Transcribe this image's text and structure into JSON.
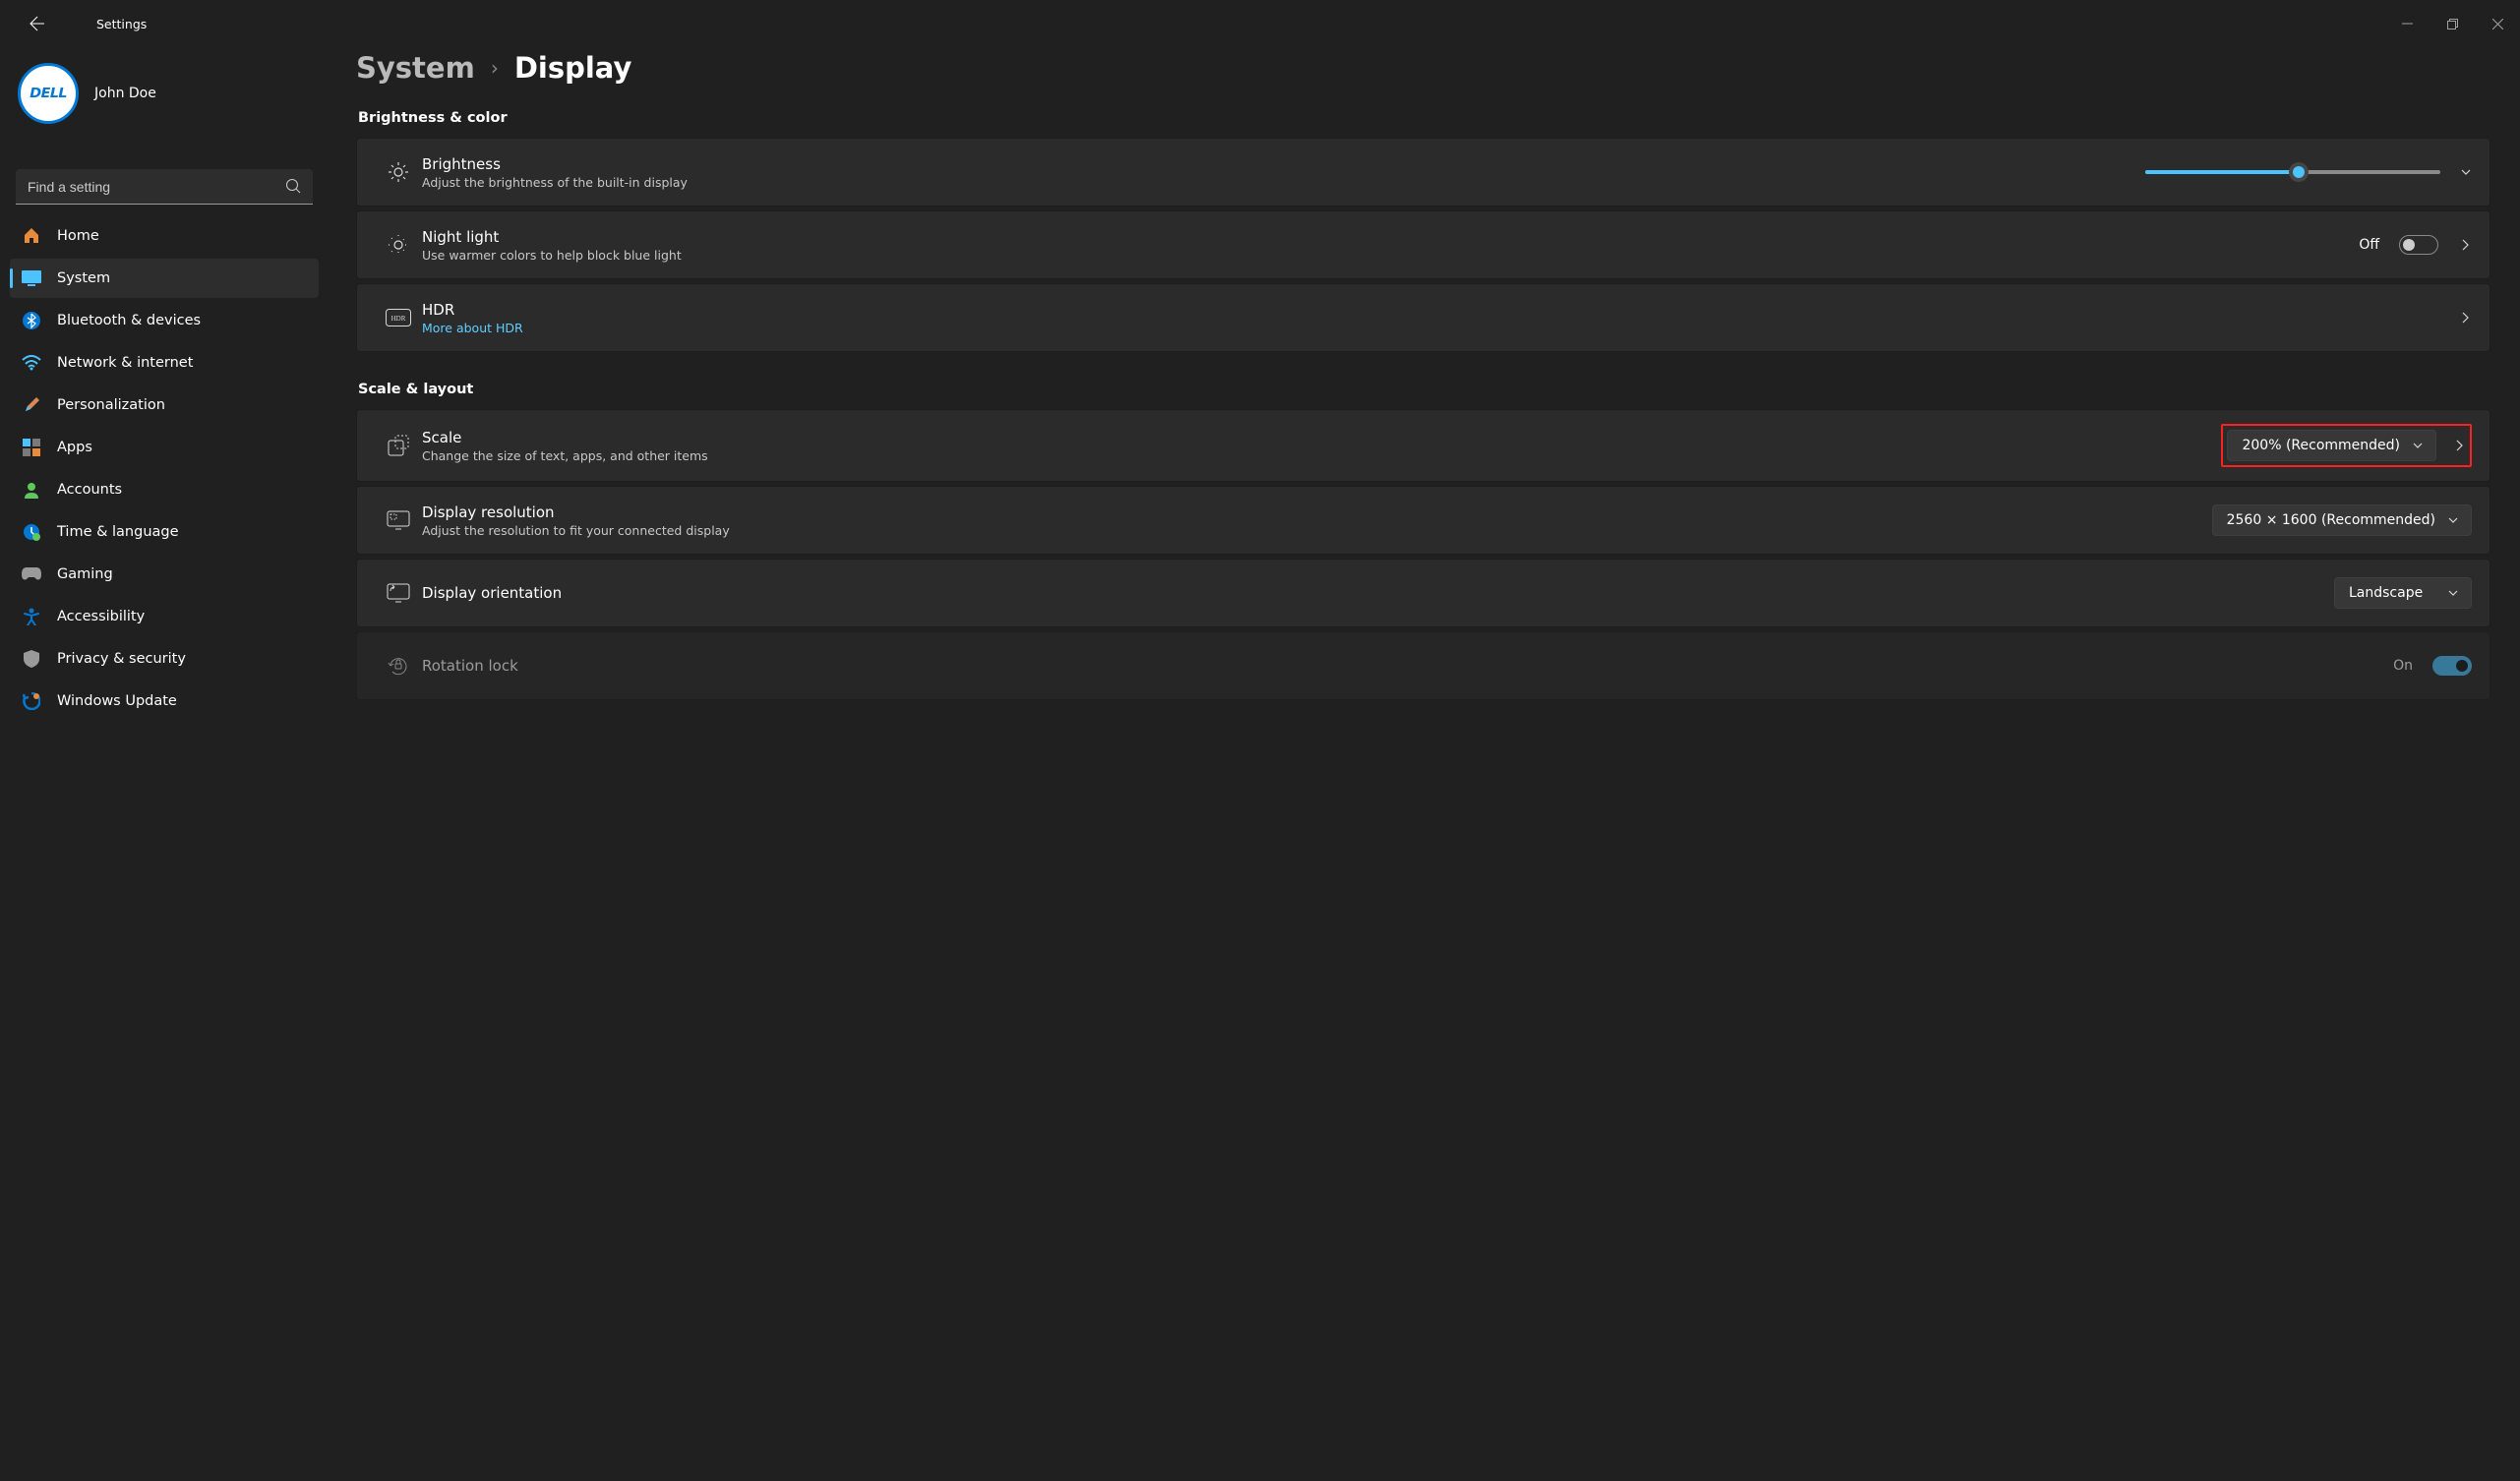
{
  "window": {
    "title": "Settings"
  },
  "user": {
    "name": "John Doe",
    "logo_text": "DELL"
  },
  "search": {
    "placeholder": "Find a setting"
  },
  "nav": {
    "items": [
      {
        "label": "Home"
      },
      {
        "label": "System"
      },
      {
        "label": "Bluetooth & devices"
      },
      {
        "label": "Network & internet"
      },
      {
        "label": "Personalization"
      },
      {
        "label": "Apps"
      },
      {
        "label": "Accounts"
      },
      {
        "label": "Time & language"
      },
      {
        "label": "Gaming"
      },
      {
        "label": "Accessibility"
      },
      {
        "label": "Privacy & security"
      },
      {
        "label": "Windows Update"
      }
    ]
  },
  "breadcrumb": {
    "parent": "System",
    "current": "Display"
  },
  "sections": {
    "brightness_color": {
      "heading": "Brightness & color",
      "brightness": {
        "title": "Brightness",
        "sub": "Adjust the brightness of the built-in display",
        "value_pct": 52
      },
      "nightlight": {
        "title": "Night light",
        "sub": "Use warmer colors to help block blue light",
        "state_label": "Off"
      },
      "hdr": {
        "title": "HDR",
        "link": "More about HDR"
      }
    },
    "scale_layout": {
      "heading": "Scale & layout",
      "scale": {
        "title": "Scale",
        "sub": "Change the size of text, apps, and other items",
        "value": "200% (Recommended)"
      },
      "resolution": {
        "title": "Display resolution",
        "sub": "Adjust the resolution to fit your connected display",
        "value": "2560 × 1600 (Recommended)"
      },
      "orientation": {
        "title": "Display orientation",
        "value": "Landscape"
      },
      "rotation": {
        "title": "Rotation lock",
        "state_label": "On"
      }
    }
  }
}
